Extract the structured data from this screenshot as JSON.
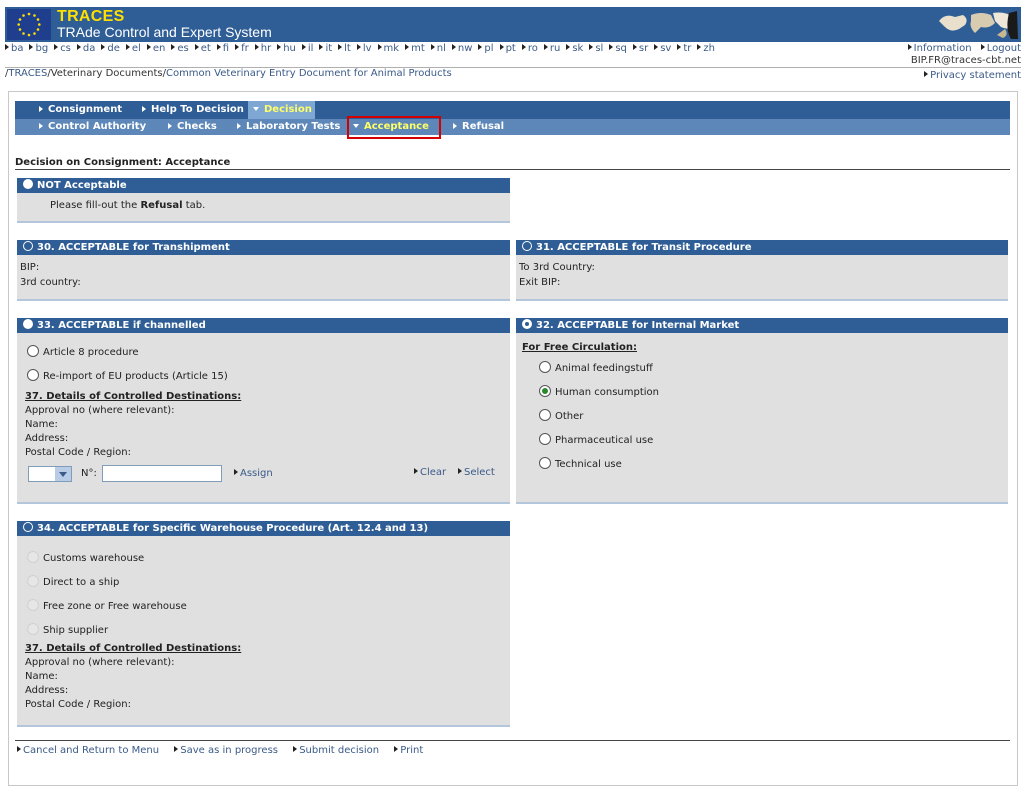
{
  "header": {
    "title": "TRACES",
    "subtitle": "TRAde Control and Expert System",
    "languages": [
      "ba",
      "bg",
      "cs",
      "da",
      "de",
      "el",
      "en",
      "es",
      "et",
      "fi",
      "fr",
      "hr",
      "hu",
      "il",
      "it",
      "lt",
      "lv",
      "mk",
      "mt",
      "nl",
      "nw",
      "pl",
      "pt",
      "ro",
      "ru",
      "sk",
      "sl",
      "sq",
      "sr",
      "sv",
      "tr",
      "zh"
    ],
    "information_label": "Information",
    "logout_label": "Logout",
    "user_email": "BIP.FR@traces-cbt.net",
    "privacy_label": "Privacy statement"
  },
  "breadcrumb": {
    "items": [
      "TRACES",
      "Veterinary Documents",
      "Common Veterinary Entry Document for Animal Products"
    ]
  },
  "tabs": {
    "top": [
      "Consignment",
      "Help To Decision",
      "Decision"
    ],
    "sub": [
      "Control Authority",
      "Checks",
      "Laboratory Tests",
      "Acceptance",
      "Refusal"
    ]
  },
  "page": {
    "heading": "Decision on Consignment: Acceptance"
  },
  "not_acceptable": {
    "title": "NOT Acceptable",
    "message_pre": "Please fill-out the ",
    "message_bold": "Refusal",
    "message_post": " tab."
  },
  "transhipment": {
    "title": "30. ACCEPTABLE for Transhipment",
    "bip_label": "BIP:",
    "country_label": "3rd country:"
  },
  "transit": {
    "title": "31. ACCEPTABLE for Transit Procedure",
    "country_label": "To 3rd Country:",
    "exit_label": "Exit BIP:"
  },
  "channelled": {
    "title": "33. ACCEPTABLE if channelled",
    "option1": "Article 8 procedure",
    "option2": "Re-import of EU products (Article 15)",
    "details_title": "37. Details of Controlled Destinations:",
    "approval_label": "Approval no (where relevant):",
    "name_label": "Name:",
    "address_label": "Address:",
    "postal_label": "Postal Code / Region:",
    "no_label": "N°:",
    "assign_label": "Assign",
    "clear_label": "Clear",
    "select_label": "Select"
  },
  "internal_market": {
    "title": "32. ACCEPTABLE for Internal Market",
    "free_circulation": "For Free Circulation:",
    "options": [
      "Animal feedingstuff",
      "Human consumption",
      "Other",
      "Pharmaceutical use",
      "Technical use"
    ],
    "selected_index": 1
  },
  "warehouse": {
    "title": "34. ACCEPTABLE for Specific Warehouse Procedure (Art. 12.4 and 13)",
    "options": [
      "Customs warehouse",
      "Direct to a ship",
      "Free zone or Free warehouse",
      "Ship supplier"
    ],
    "details_title": "37. Details of Controlled Destinations:",
    "approval_label": "Approval no (where relevant):",
    "name_label": "Name:",
    "address_label": "Address:",
    "postal_label": "Postal Code / Region:"
  },
  "footer": {
    "cancel_label": "Cancel and Return to Menu",
    "save_label": "Save as in progress",
    "submit_label": "Submit decision",
    "print_label": "Print"
  }
}
